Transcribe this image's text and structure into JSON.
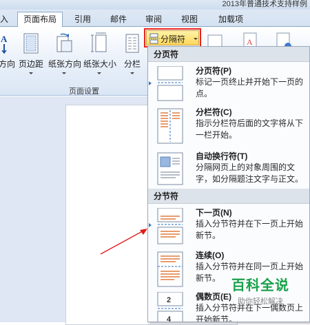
{
  "window": {
    "title": "2013年普通技术支持样例"
  },
  "tabs": [
    {
      "label": "入"
    },
    {
      "label": "页面布局"
    },
    {
      "label": "引用"
    },
    {
      "label": "邮件"
    },
    {
      "label": "审阅"
    },
    {
      "label": "视图"
    },
    {
      "label": "加载项"
    }
  ],
  "ribbon": {
    "buttons": [
      {
        "label": "方向",
        "icon": "text-direction-icon"
      },
      {
        "label": "页边距",
        "icon": "margins-icon"
      },
      {
        "label": "纸张方向",
        "icon": "orientation-icon"
      },
      {
        "label": "纸张大小",
        "icon": "size-icon"
      },
      {
        "label": "分栏",
        "icon": "columns-icon"
      }
    ],
    "group_label": "页面设置",
    "breaks_button": {
      "label": "分隔符",
      "icon": "breaks-icon"
    }
  },
  "dropdown": {
    "page_breaks_header": "分页符",
    "section_breaks_header": "分节符",
    "items": [
      {
        "title": "分页符(P)",
        "desc": "标记一页终止并开始下一页的点。",
        "icon": "page-break-icon"
      },
      {
        "title": "分栏符(C)",
        "desc": "指示分栏符后面的文字将从下一栏开始。",
        "icon": "column-break-icon"
      },
      {
        "title": "自动换行符(T)",
        "desc": "分隔网页上的对象周围的文字，如分隔题注文字与正文。",
        "icon": "text-wrapping-break-icon"
      },
      {
        "title": "下一页(N)",
        "desc": "插入分节符并在下一页上开始新节。",
        "icon": "next-page-section-icon"
      },
      {
        "title": "连续(O)",
        "desc": "插入分节符并在同一页上开始新节。",
        "icon": "continuous-section-icon"
      },
      {
        "title": "偶数页(E)",
        "desc": "插入分节符并在下一偶数页上开始新节。",
        "icon": "even-page-section-icon"
      }
    ]
  },
  "watermark": {
    "title": "百科全说",
    "subtitle": "助你轻松解决"
  },
  "colors": {
    "highlight": "#e8231d",
    "accent": "#3d73c0",
    "watermark": "#1aa04a"
  }
}
